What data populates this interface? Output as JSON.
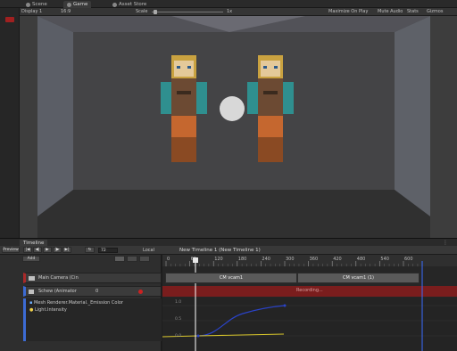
{
  "tabs": {
    "scene": "Scene",
    "game": "Game",
    "asset_store": "Asset Store"
  },
  "game_toolbar": {
    "display": "Display 1",
    "aspect": "16:9",
    "scale_label": "Scale",
    "scale_value": "1x",
    "maximize": "Maximize On Play",
    "mute": "Mute Audio",
    "stats": "Stats",
    "gizmos": "Gizmos"
  },
  "timeline": {
    "tab_label": "Timeline",
    "preview_button": "Preview",
    "frame_value": "72",
    "local_label": "Local",
    "breadcrumb": "New Timeline 1 (New Timeline 1)",
    "add_button": "Add",
    "ruler_ticks": [
      "0",
      "60",
      "120",
      "180",
      "240",
      "300",
      "360",
      "420",
      "480",
      "540",
      "600"
    ],
    "tracks": [
      {
        "label": "Main Camera (Cin"
      },
      {
        "label": "Schew (Animator",
        "value": "0"
      }
    ],
    "sub_tracks": [
      {
        "label": "Mesh Renderer.Material._Emission Color"
      },
      {
        "label": "Light.Intensity"
      }
    ],
    "clips": [
      {
        "label": "CM vcam1"
      },
      {
        "label": "CM vcam1 (1)"
      },
      {
        "label": "Recording..."
      }
    ],
    "curve_labels": [
      "1.0",
      "0.5",
      "0.0"
    ]
  },
  "colors": {
    "recording": "#7a1d1d",
    "curve_blue": "#2a43c9",
    "curve_yellow": "#d7c52b",
    "playhead": "#ffffff",
    "end_marker": "#3a6cff"
  }
}
